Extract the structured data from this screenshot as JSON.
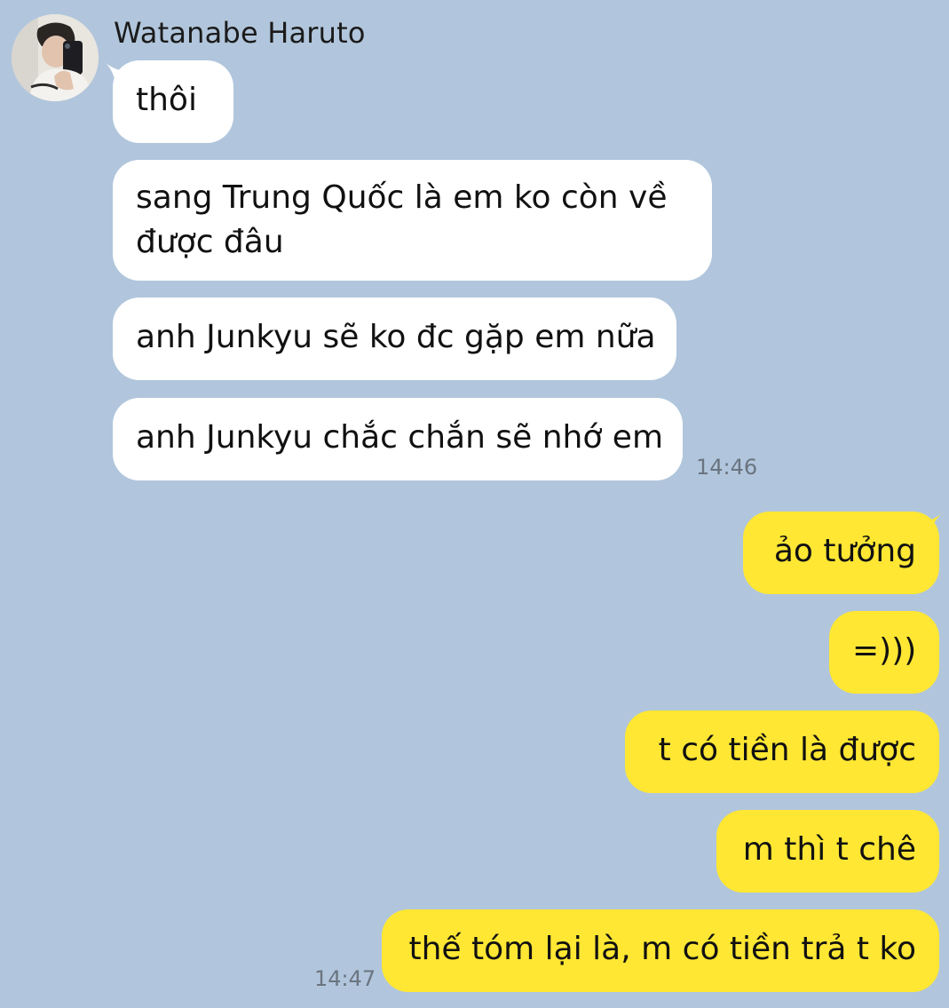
{
  "contact": {
    "name": "Watanabe Haruto",
    "avatar_icon": "profile-photo-avatar"
  },
  "colors": {
    "background": "#b1c6dc",
    "incoming_bubble": "#ffffff",
    "outgoing_bubble": "#ffe733",
    "timestamp": "#6a7480"
  },
  "incoming": [
    {
      "text": "thôi"
    },
    {
      "text": "sang Trung Quốc là em ko còn về được đâu"
    },
    {
      "text": "anh Junkyu sẽ ko đc gặp em nữa"
    },
    {
      "text": "anh Junkyu chắc chắn sẽ nhớ em"
    }
  ],
  "incoming_time": "14:46",
  "outgoing": [
    {
      "text": "ảo tưởng"
    },
    {
      "text": "=)))"
    },
    {
      "text": "t có tiền là được"
    },
    {
      "text": "m thì t chê"
    },
    {
      "text": "thế tóm lại là, m có tiền trả t ko"
    }
  ],
  "outgoing_time": "14:47"
}
